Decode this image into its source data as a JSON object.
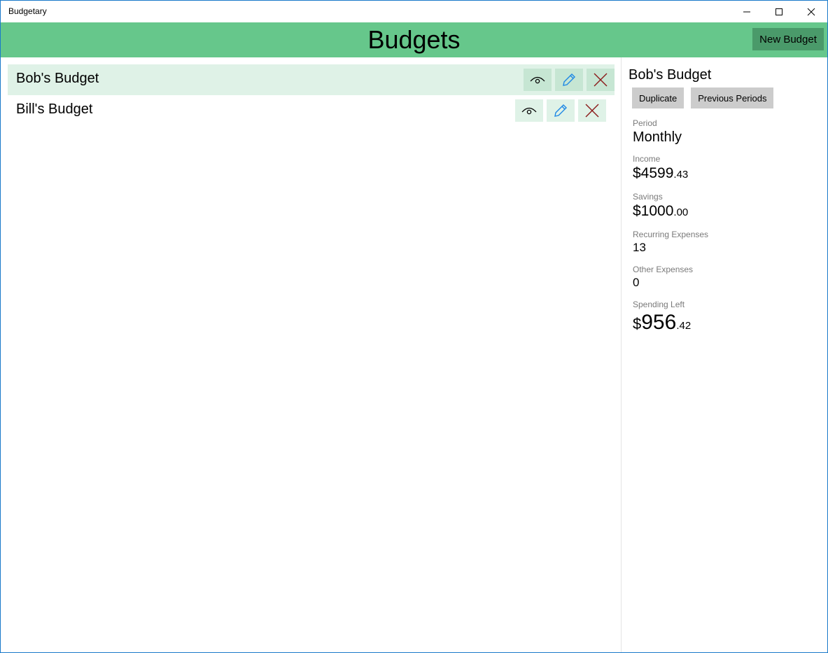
{
  "app": {
    "title": "Budgetary"
  },
  "header": {
    "title": "Budgets",
    "new_budget_label": "New Budget",
    "color": "#66c78b"
  },
  "budgets": [
    {
      "name": "Bob's Budget",
      "selected": true
    },
    {
      "name": "Bill's Budget",
      "selected": false
    }
  ],
  "details": {
    "title": "Bob's Budget",
    "duplicate_label": "Duplicate",
    "previous_periods_label": "Previous Periods",
    "period_label": "Period",
    "period_value": "Monthly",
    "income_label": "Income",
    "income_dollars": "$4599",
    "income_cents": ".43",
    "savings_label": "Savings",
    "savings_dollars": "$1000",
    "savings_cents": ".00",
    "recurring_label": "Recurring Expenses",
    "recurring_value": "13",
    "other_label": "Other Expenses",
    "other_value": "0",
    "spending_label": "Spending Left",
    "spending_sign": "$",
    "spending_dollars": "956",
    "spending_cents": ".42"
  },
  "icons": {
    "view": "eye-icon",
    "edit": "pencil-icon",
    "delete": "close-icon",
    "edit_color": "#1e88e5",
    "delete_color": "#8b1a1a"
  }
}
